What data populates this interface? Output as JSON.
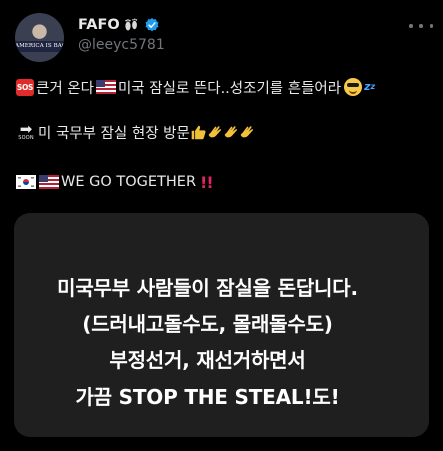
{
  "author": {
    "display_name": "FAFO",
    "name_emoji": "footprints-icon",
    "handle": "@leeyc5781",
    "verified": true,
    "avatar_caption": "AMERICA IS BACK"
  },
  "tweet": {
    "line1_text": "큰거 온다 ",
    "line1_text2": "미국 잠실로 뜬다..성조기를 흔들어라",
    "line2_text": "미 국무부 잠실 현장 방문 ",
    "line3_text": " WE GO TOGETHER ",
    "sos_label": "SOS",
    "soon_label": "SOON",
    "zzz_label": "z",
    "bang_label": "!!"
  },
  "media": {
    "lines": [
      "미국무부 사람들이 잠실을 돈답니다.",
      "(드러내고돌수도, 몰래돌수도)",
      "부정선거, 재선거하면서",
      "가끔 STOP THE STEAL!도!"
    ]
  },
  "colors": {
    "background": "#000000",
    "text": "#e7e9ea",
    "secondary": "#71767b",
    "verified": "#1d9bf0",
    "card": "#1f1f1f"
  }
}
